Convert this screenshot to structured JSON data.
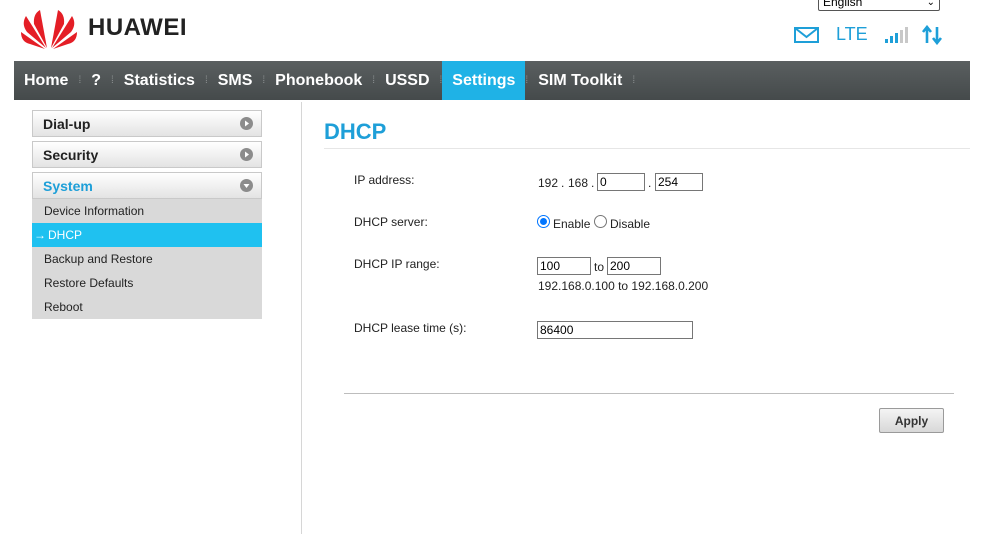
{
  "brand": {
    "name": "HUAWEI",
    "color": "#e41e26"
  },
  "header": {
    "language": "English",
    "network_type": "LTE",
    "icons": [
      "mail-icon",
      "signal-icon",
      "data-transfer-icon"
    ]
  },
  "nav": {
    "items": [
      "Home",
      "?",
      "Statistics",
      "SMS",
      "Phonebook",
      "USSD",
      "Settings",
      "SIM Toolkit"
    ],
    "active": "Settings",
    "separator": "⁞"
  },
  "sidebar": {
    "sections": [
      {
        "label": "Dial-up"
      },
      {
        "label": "Security"
      },
      {
        "label": "System"
      }
    ],
    "system_items": [
      "Device Information",
      "DHCP",
      "Backup and Restore",
      "Restore Defaults",
      "Reboot"
    ],
    "active_prefix": "→"
  },
  "main": {
    "title": "DHCP",
    "ip_address": {
      "label": "IP address:",
      "fixed1": "192",
      "fixed2": "168",
      "dot": ".",
      "octet3": "0",
      "octet4": "254"
    },
    "dhcp_server": {
      "label": "DHCP server:",
      "enable": "Enable",
      "disable": "Disable",
      "selected": "Enable"
    },
    "dhcp_range": {
      "label": "DHCP IP range:",
      "start": "100",
      "to": "to",
      "end": "200",
      "summary": "192.168.0.100 to 192.168.0.200"
    },
    "lease": {
      "label": "DHCP lease time (s):",
      "value": "86400"
    },
    "apply": "Apply"
  },
  "colors": {
    "accent": "#1e9fd8",
    "nav_active": "#1fb2e6",
    "nav_bg": "#4f5455"
  }
}
